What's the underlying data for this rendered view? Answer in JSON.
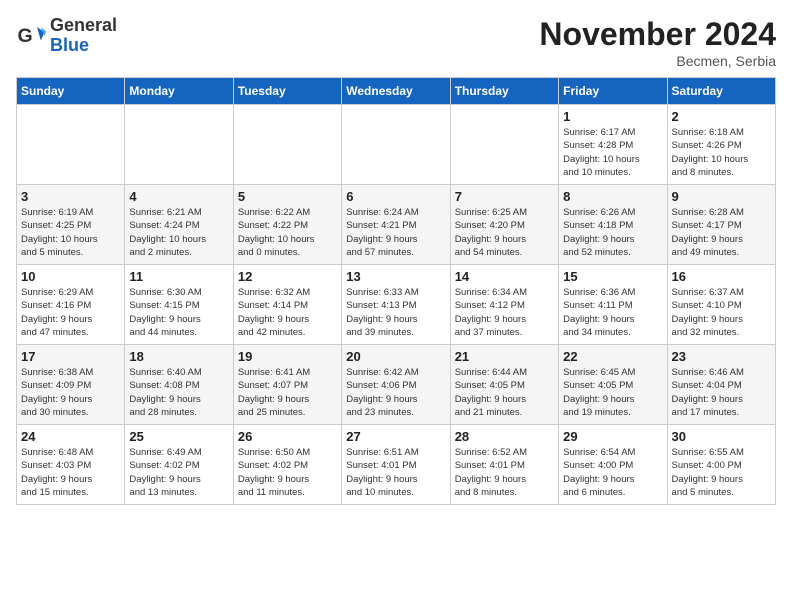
{
  "header": {
    "logo_general": "General",
    "logo_blue": "Blue",
    "month": "November 2024",
    "location": "Becmen, Serbia"
  },
  "days_of_week": [
    "Sunday",
    "Monday",
    "Tuesday",
    "Wednesday",
    "Thursday",
    "Friday",
    "Saturday"
  ],
  "weeks": [
    [
      {
        "day": "",
        "info": ""
      },
      {
        "day": "",
        "info": ""
      },
      {
        "day": "",
        "info": ""
      },
      {
        "day": "",
        "info": ""
      },
      {
        "day": "",
        "info": ""
      },
      {
        "day": "1",
        "info": "Sunrise: 6:17 AM\nSunset: 4:28 PM\nDaylight: 10 hours\nand 10 minutes."
      },
      {
        "day": "2",
        "info": "Sunrise: 6:18 AM\nSunset: 4:26 PM\nDaylight: 10 hours\nand 8 minutes."
      }
    ],
    [
      {
        "day": "3",
        "info": "Sunrise: 6:19 AM\nSunset: 4:25 PM\nDaylight: 10 hours\nand 5 minutes."
      },
      {
        "day": "4",
        "info": "Sunrise: 6:21 AM\nSunset: 4:24 PM\nDaylight: 10 hours\nand 2 minutes."
      },
      {
        "day": "5",
        "info": "Sunrise: 6:22 AM\nSunset: 4:22 PM\nDaylight: 10 hours\nand 0 minutes."
      },
      {
        "day": "6",
        "info": "Sunrise: 6:24 AM\nSunset: 4:21 PM\nDaylight: 9 hours\nand 57 minutes."
      },
      {
        "day": "7",
        "info": "Sunrise: 6:25 AM\nSunset: 4:20 PM\nDaylight: 9 hours\nand 54 minutes."
      },
      {
        "day": "8",
        "info": "Sunrise: 6:26 AM\nSunset: 4:18 PM\nDaylight: 9 hours\nand 52 minutes."
      },
      {
        "day": "9",
        "info": "Sunrise: 6:28 AM\nSunset: 4:17 PM\nDaylight: 9 hours\nand 49 minutes."
      }
    ],
    [
      {
        "day": "10",
        "info": "Sunrise: 6:29 AM\nSunset: 4:16 PM\nDaylight: 9 hours\nand 47 minutes."
      },
      {
        "day": "11",
        "info": "Sunrise: 6:30 AM\nSunset: 4:15 PM\nDaylight: 9 hours\nand 44 minutes."
      },
      {
        "day": "12",
        "info": "Sunrise: 6:32 AM\nSunset: 4:14 PM\nDaylight: 9 hours\nand 42 minutes."
      },
      {
        "day": "13",
        "info": "Sunrise: 6:33 AM\nSunset: 4:13 PM\nDaylight: 9 hours\nand 39 minutes."
      },
      {
        "day": "14",
        "info": "Sunrise: 6:34 AM\nSunset: 4:12 PM\nDaylight: 9 hours\nand 37 minutes."
      },
      {
        "day": "15",
        "info": "Sunrise: 6:36 AM\nSunset: 4:11 PM\nDaylight: 9 hours\nand 34 minutes."
      },
      {
        "day": "16",
        "info": "Sunrise: 6:37 AM\nSunset: 4:10 PM\nDaylight: 9 hours\nand 32 minutes."
      }
    ],
    [
      {
        "day": "17",
        "info": "Sunrise: 6:38 AM\nSunset: 4:09 PM\nDaylight: 9 hours\nand 30 minutes."
      },
      {
        "day": "18",
        "info": "Sunrise: 6:40 AM\nSunset: 4:08 PM\nDaylight: 9 hours\nand 28 minutes."
      },
      {
        "day": "19",
        "info": "Sunrise: 6:41 AM\nSunset: 4:07 PM\nDaylight: 9 hours\nand 25 minutes."
      },
      {
        "day": "20",
        "info": "Sunrise: 6:42 AM\nSunset: 4:06 PM\nDaylight: 9 hours\nand 23 minutes."
      },
      {
        "day": "21",
        "info": "Sunrise: 6:44 AM\nSunset: 4:05 PM\nDaylight: 9 hours\nand 21 minutes."
      },
      {
        "day": "22",
        "info": "Sunrise: 6:45 AM\nSunset: 4:05 PM\nDaylight: 9 hours\nand 19 minutes."
      },
      {
        "day": "23",
        "info": "Sunrise: 6:46 AM\nSunset: 4:04 PM\nDaylight: 9 hours\nand 17 minutes."
      }
    ],
    [
      {
        "day": "24",
        "info": "Sunrise: 6:48 AM\nSunset: 4:03 PM\nDaylight: 9 hours\nand 15 minutes."
      },
      {
        "day": "25",
        "info": "Sunrise: 6:49 AM\nSunset: 4:02 PM\nDaylight: 9 hours\nand 13 minutes."
      },
      {
        "day": "26",
        "info": "Sunrise: 6:50 AM\nSunset: 4:02 PM\nDaylight: 9 hours\nand 11 minutes."
      },
      {
        "day": "27",
        "info": "Sunrise: 6:51 AM\nSunset: 4:01 PM\nDaylight: 9 hours\nand 10 minutes."
      },
      {
        "day": "28",
        "info": "Sunrise: 6:52 AM\nSunset: 4:01 PM\nDaylight: 9 hours\nand 8 minutes."
      },
      {
        "day": "29",
        "info": "Sunrise: 6:54 AM\nSunset: 4:00 PM\nDaylight: 9 hours\nand 6 minutes."
      },
      {
        "day": "30",
        "info": "Sunrise: 6:55 AM\nSunset: 4:00 PM\nDaylight: 9 hours\nand 5 minutes."
      }
    ]
  ]
}
